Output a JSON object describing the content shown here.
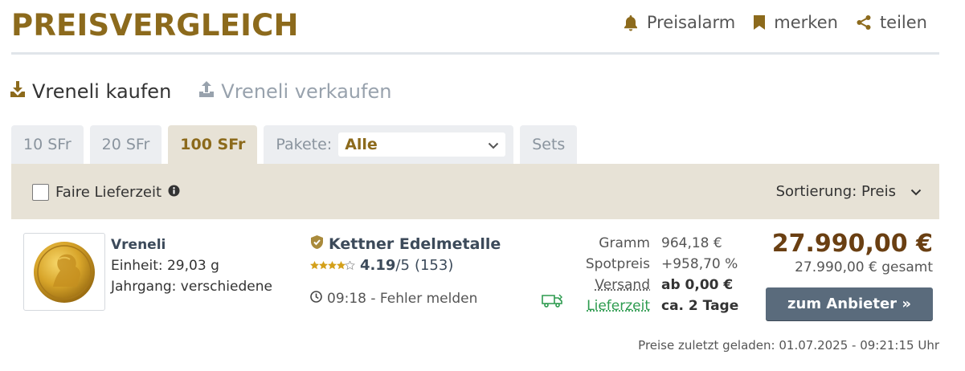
{
  "header": {
    "title": "PREISVERGLEICH",
    "actions": [
      {
        "icon": "bell-icon",
        "label": "Preisalarm"
      },
      {
        "icon": "bookmark-icon",
        "label": "merken"
      },
      {
        "icon": "share-icon",
        "label": "teilen"
      }
    ]
  },
  "modes": {
    "buy": "Vreneli kaufen",
    "sell": "Vreneli verkaufen"
  },
  "tabs": {
    "items": [
      "10 SFr",
      "20 SFr",
      "100 SFr"
    ],
    "active": "100 SFr",
    "pakete_label": "Pakete:",
    "pakete_selected": "Alle",
    "sets": "Sets"
  },
  "filters": {
    "fair_delivery_label": "Faire Lieferzeit",
    "fair_delivery_checked": false,
    "sort_label": "Sortierung: Preis"
  },
  "offer": {
    "product_name": "Vreneli",
    "unit": "Einheit: 29,03 g",
    "year": "Jahrgang: verschiedene",
    "dealer_name": "Kettner Edelmetalle",
    "rating_value": "4.19",
    "rating_suffix": "/5",
    "rating_count": "(153)",
    "rating_stars": 4,
    "time_text": "09:18 - Fehler melden",
    "details": [
      {
        "label": "Gramm",
        "value": "964,18 €"
      },
      {
        "label": "Spotpreis",
        "value": "+958,70 %"
      },
      {
        "label": "Versand",
        "value": "ab 0,00 €"
      },
      {
        "label": "Lieferzeit",
        "value": "ca. 2 Tage"
      }
    ],
    "price": "27.990,00 €",
    "price_total": "27.990,00 € gesamt",
    "cta": "zum Anbieter »"
  },
  "footer": {
    "loaded_text": "Preise zuletzt geladen: 01.07.2025 - 09:21:15 Uhr"
  },
  "colors": {
    "brand": "#8c6a1c",
    "price": "#6a3f12",
    "cta": "#5a6b7c",
    "green": "#2d9b4f",
    "filter_bar": "#e7e2d6"
  }
}
